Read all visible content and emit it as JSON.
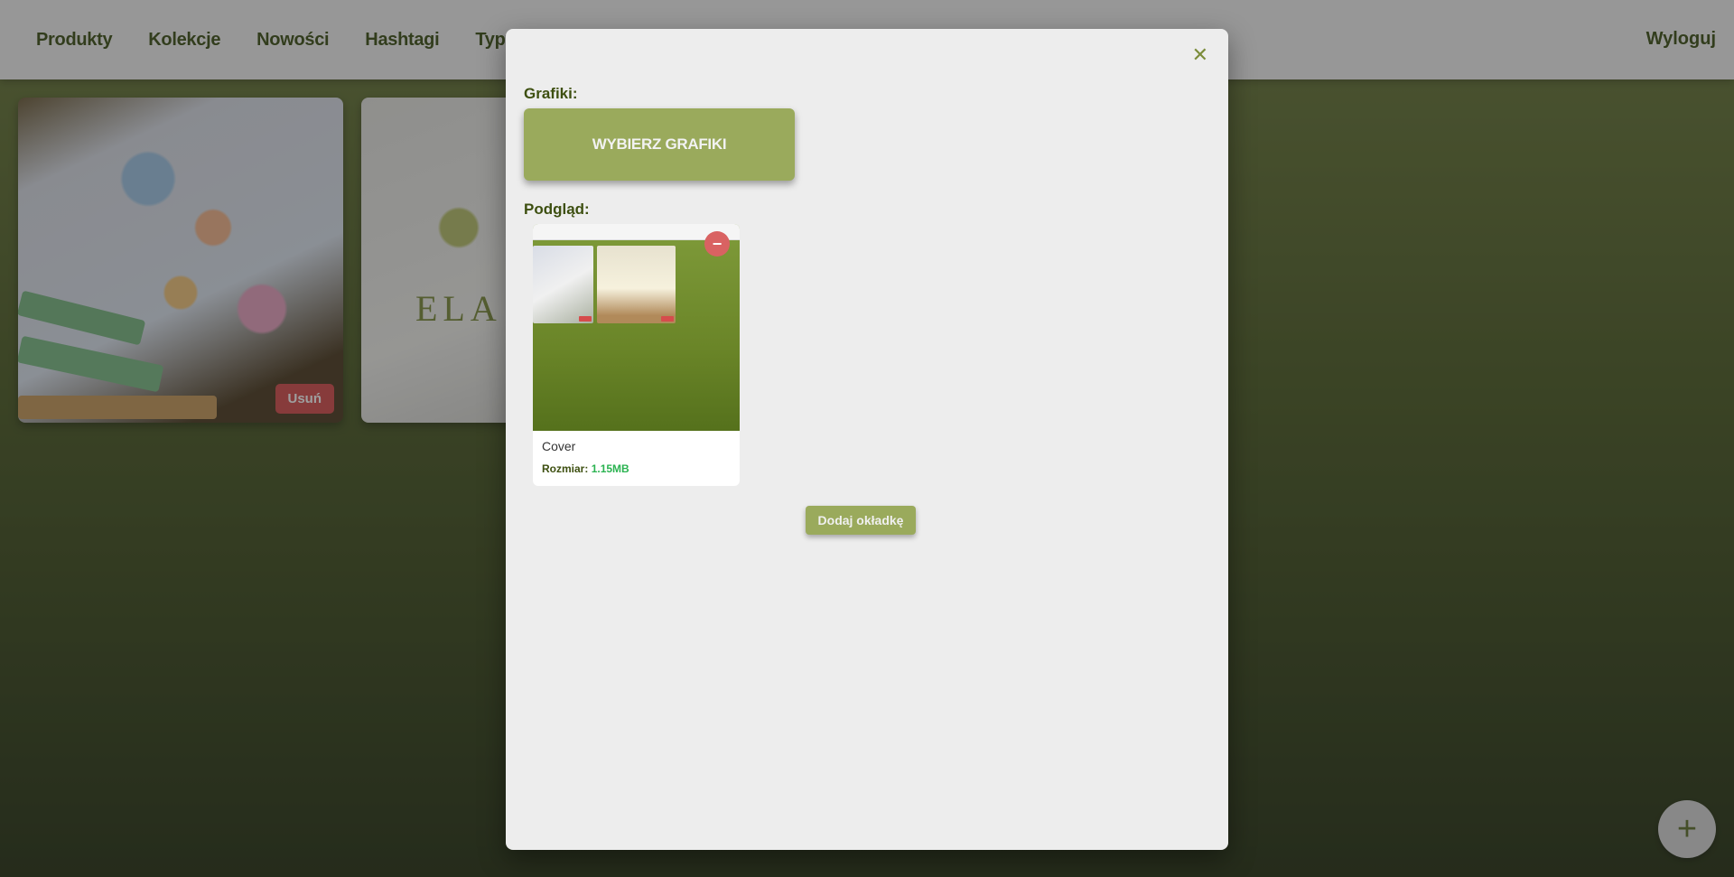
{
  "nav": {
    "items": [
      {
        "label": "Produkty"
      },
      {
        "label": "Kolekcje"
      },
      {
        "label": "Nowości"
      },
      {
        "label": "Hashtagi"
      },
      {
        "label": "Typy Produ"
      }
    ],
    "logout_label": "Wyloguj"
  },
  "cards": [
    {
      "remove_label": "Usuń",
      "logo_text": ""
    },
    {
      "logo_text": "ELA"
    }
  ],
  "fab": {
    "icon": "plus-icon",
    "glyph": "+"
  },
  "modal": {
    "close_icon": "close-icon",
    "close_glyph": "✕",
    "graphics_label": "Grafiki:",
    "choose_button_label": "WYBIERZ GRAFIKI",
    "preview_label": "Podgląd:",
    "preview": {
      "name": "Cover",
      "size_label": "Rozmiar:",
      "size_value": "1.15MB",
      "remove_glyph": "−"
    },
    "add_cover_label": "Dodaj okładkę"
  },
  "colors": {
    "accent": "#9aaa5c",
    "dark_green": "#3d4f10",
    "danger": "#d64c4c",
    "size_green": "#2bb351"
  }
}
